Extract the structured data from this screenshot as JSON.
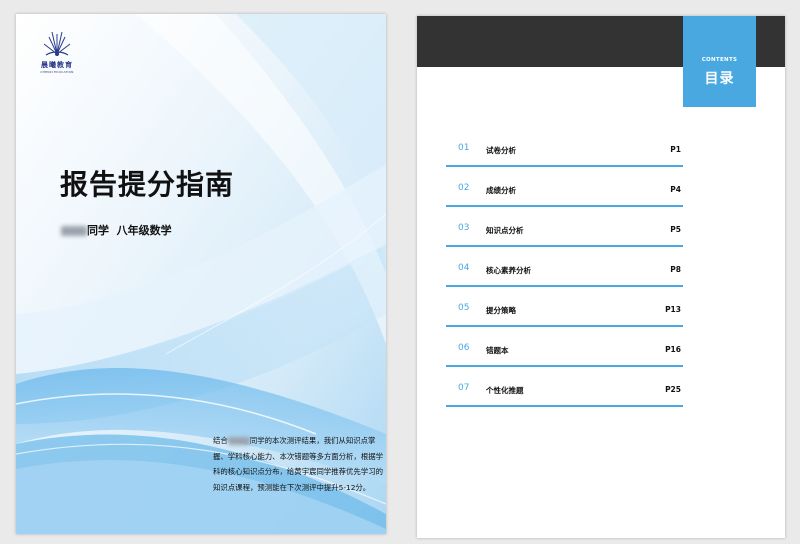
{
  "cover": {
    "logo": {
      "name": "晨曦教育",
      "english": "CHENXI EDUCATION"
    },
    "title": "报告提分指南",
    "student_suffix": "同学",
    "grade_subject": "八年级数学",
    "desc_line1_a": "结合",
    "desc_line1_b": "同学的本次测评结果，我们从知识点掌握、学科核心能力、本次错题等多方面分析，根据学科的核心知识点分布，给黄宇宸同学推荐优先学习的知识点课程，预测能在下次测评中提升5-12分。",
    "colors": {
      "accent": "#4aa8e0",
      "wave_light": "#cfe7f8",
      "wave_mid": "#8cc9ef"
    }
  },
  "toc": {
    "badge_en": "CONTENTS",
    "badge_cn": "目录",
    "items": [
      {
        "num": "01",
        "label": "试卷分析",
        "page": "P1"
      },
      {
        "num": "02",
        "label": "成绩分析",
        "page": "P4"
      },
      {
        "num": "03",
        "label": "知识点分析",
        "page": "P5"
      },
      {
        "num": "04",
        "label": "核心素养分析",
        "page": "P8"
      },
      {
        "num": "05",
        "label": "提分策略",
        "page": "P13"
      },
      {
        "num": "06",
        "label": "错题本",
        "page": "P16"
      },
      {
        "num": "07",
        "label": "个性化推题",
        "page": "P25"
      }
    ]
  }
}
